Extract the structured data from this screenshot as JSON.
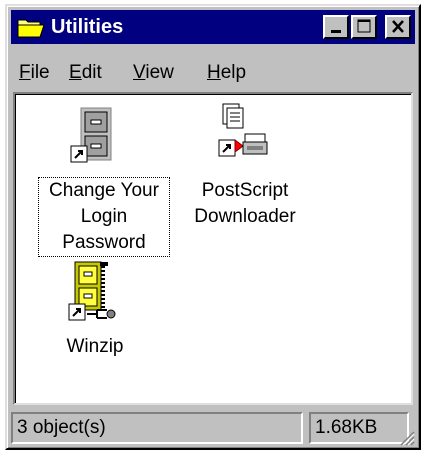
{
  "window": {
    "title": "Utilities",
    "title_icon": "folder-open-icon",
    "titlebar_color": "#000080"
  },
  "menu": [
    {
      "label": "File",
      "accel": "F",
      "rest": "ile"
    },
    {
      "label": "Edit",
      "accel": "E",
      "rest": "dit"
    },
    {
      "label": "View",
      "accel": "V",
      "rest": "iew"
    },
    {
      "label": "Help",
      "accel": "H",
      "rest": "elp"
    }
  ],
  "items": [
    {
      "label_lines": [
        "Change Your",
        "Login",
        "Password"
      ],
      "icon": "filing-cabinet-shortcut-icon",
      "selected": true
    },
    {
      "label_lines": [
        "PostScript",
        "Downloader"
      ],
      "icon": "printer-shortcut-icon",
      "selected": false
    },
    {
      "label_lines": [
        "Winzip"
      ],
      "icon": "winzip-shortcut-icon",
      "selected": false
    }
  ],
  "status": {
    "objects": "3 object(s)",
    "size": "1.68KB"
  }
}
